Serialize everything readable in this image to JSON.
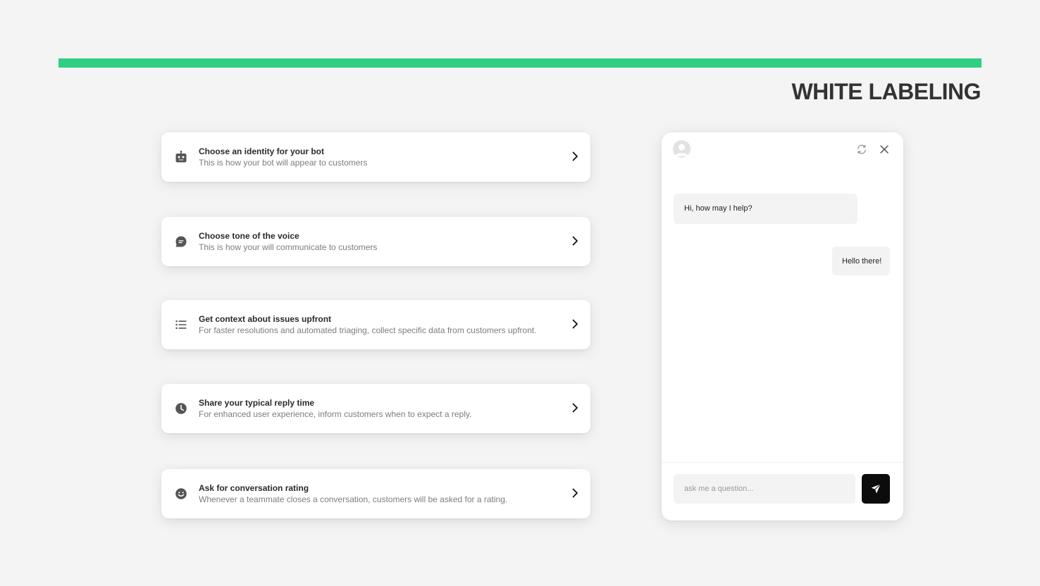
{
  "colors": {
    "accent": "#2ecf80",
    "icon": "#555555"
  },
  "header": {
    "title": "WHITE LABELING"
  },
  "features": [
    {
      "icon": "robot-icon",
      "title": "Choose an identity for your bot",
      "subtitle": "This is how your bot will appear to customers"
    },
    {
      "icon": "chat-bubble-icon",
      "title": "Choose tone of the voice",
      "subtitle": "This is how your will communicate to customers"
    },
    {
      "icon": "list-icon",
      "title": "Get context about issues upfront",
      "subtitle": "For faster resolutions and automated triaging, collect specific data from customers upfront."
    },
    {
      "icon": "clock-icon",
      "title": "Share your typical reply time",
      "subtitle": "For enhanced user experience, inform customers when to expect a reply."
    },
    {
      "icon": "smiley-icon",
      "title": "Ask for conversation rating",
      "subtitle": "Whenever a teammate closes a conversation, customers will be asked for a rating."
    }
  ],
  "chat": {
    "header_icons": [
      "user-avatar-icon",
      "refresh-icon",
      "close-icon"
    ],
    "messages": [
      {
        "sender": "bot",
        "text": "Hi, how may I help?"
      },
      {
        "sender": "user",
        "text": "Hello there!"
      }
    ],
    "input": {
      "value": "",
      "placeholder": "ask me a question..."
    },
    "send_icon": "send-icon"
  }
}
